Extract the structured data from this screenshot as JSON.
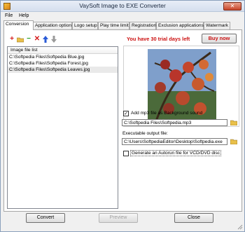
{
  "window": {
    "title": "VaySoft Image to EXE Converter",
    "close_glyph": "✕"
  },
  "menu": [
    "File",
    "Help"
  ],
  "tabs": [
    "Conversion",
    "Application option",
    "Logo setup",
    "Play time limit",
    "Registration",
    "Exclusion applications",
    "Watermark"
  ],
  "toolbar": {
    "icons": [
      "add-icon",
      "open-folder-icon",
      "remove-icon",
      "delete-icon",
      "move-up-icon",
      "move-down-icon"
    ]
  },
  "file_list": {
    "header": "Image file list",
    "items": [
      "C:\\Softpedia Files\\Softpedia Blue.jpg",
      "C:\\Softpedia Files\\Softpedia Forest.jpg",
      "C:\\Softpedia Files\\Softpedia Leaves.jpg"
    ],
    "selected_index": 2
  },
  "trial_text": "You have 30 trial days left",
  "buy_label": "Buy now",
  "bg_sound": {
    "checked": true,
    "label": "Add mp3 file as Background sound",
    "path": "C:\\Softpedia Files\\Softpedia.mp3"
  },
  "output": {
    "label": "Executable output file:",
    "path": "C:\\Users\\SoftpediaEditor\\Desktop\\Softpedia.exe"
  },
  "autorun": {
    "checked": false,
    "label": "Generate an Autorun file for VCD/DVD disc"
  },
  "buttons": {
    "convert": "Convert",
    "preview": "Preview",
    "close": "Close"
  }
}
